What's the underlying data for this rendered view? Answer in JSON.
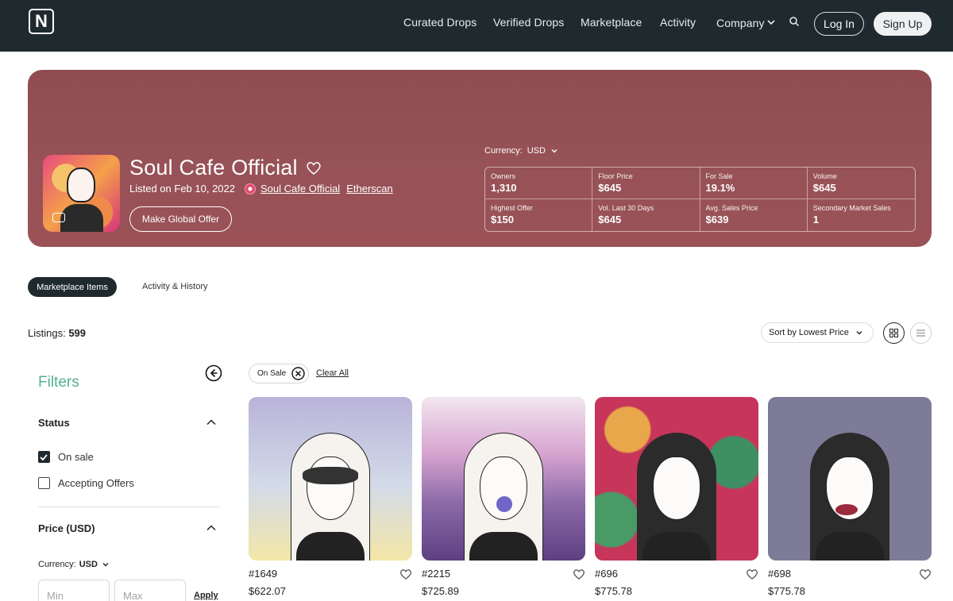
{
  "nav": {
    "logo": "N",
    "links": [
      "Curated Drops",
      "Verified Drops",
      "Marketplace",
      "Activity",
      "Company"
    ],
    "login": "Log In",
    "signup": "Sign Up"
  },
  "collection": {
    "title": "Soul Cafe Official",
    "listed": "Listed on Feb 10, 2022",
    "creator": "Soul Cafe Official",
    "etherscan": "Etherscan",
    "offer_button": "Make Global Offer",
    "currency_label": "Currency:",
    "currency_value": "USD",
    "stats": [
      {
        "label": "Owners",
        "value": "1,310"
      },
      {
        "label": "Floor Price",
        "value": "$645"
      },
      {
        "label": "For Sale",
        "value": "19.1%"
      },
      {
        "label": "Volume",
        "value": "$645"
      },
      {
        "label": "Highest Offer",
        "value": "$150"
      },
      {
        "label": "Vol. Last 30 Days",
        "value": "$645"
      },
      {
        "label": "Avg. Sales Price",
        "value": "$639"
      },
      {
        "label": "Secondary Market Sales",
        "value": "1"
      }
    ]
  },
  "tabs": {
    "active": "Marketplace Items",
    "other": "Activity & History"
  },
  "listings": {
    "label": "Listings:",
    "count": "599",
    "sort": "Sort by Lowest Price"
  },
  "filters": {
    "title": "Filters",
    "status_title": "Status",
    "options": [
      {
        "label": "On sale",
        "checked": true
      },
      {
        "label": "Accepting Offers",
        "checked": false
      }
    ],
    "price_title": "Price (USD)",
    "currency_label": "Currency:",
    "currency_value": "USD",
    "min_placeholder": "Min",
    "max_placeholder": "Max",
    "apply": "Apply"
  },
  "active_filters": {
    "chip": "On Sale",
    "clear": "Clear All"
  },
  "items": [
    {
      "id": "#1649",
      "price": "$622.07",
      "bg": "#b9b3d9"
    },
    {
      "id": "#2215",
      "price": "$725.89",
      "bg": "#8c6aa8"
    },
    {
      "id": "#696",
      "price": "$775.78",
      "bg": "#c7355a"
    },
    {
      "id": "#698",
      "price": "$775.78",
      "bg": "#7e7b99"
    }
  ],
  "colors": {
    "nav_bg": "#1f2a2e",
    "hero_bg": "#975257",
    "accent_green": "#55b08e"
  }
}
